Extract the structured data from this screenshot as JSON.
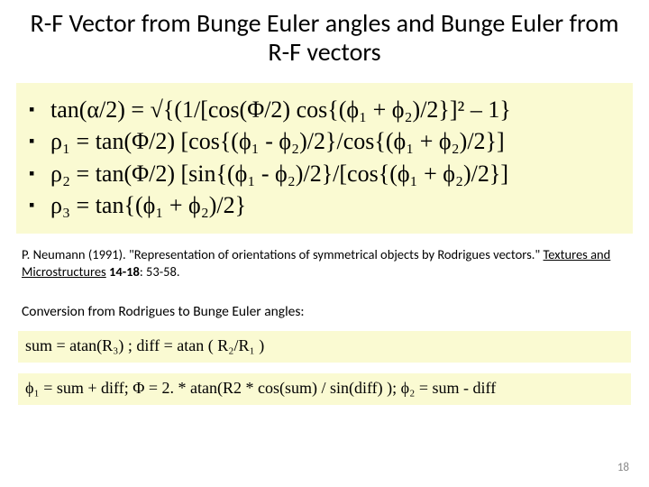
{
  "title": "R-F Vector from Bunge Euler angles and Bunge Euler from R-F vectors",
  "bullets": [
    "tan(α/2) = √{(1/[cos(Φ/2) cos{(ϕ₁ + ϕ₂)/2}]² – 1}",
    "ρ₁ = tan(Φ/2) [cos{(ϕ₁ - ϕ₂)/2}/cos{(ϕ₁ + ϕ₂)/2}]",
    "ρ₂ = tan(Φ/2) [sin{(ϕ₁ - ϕ₂)/2}/[cos{(ϕ₁ + ϕ₂)/2}]",
    "ρ₃ = tan{(ϕ₁ + ϕ₂)/2}"
  ],
  "reference": {
    "prefix": "P. Neumann (1991). \"Representation of orientations of symmetrical objects by Rodrigues vectors.\" ",
    "journal": "Textures and Microstructures",
    "suffix": " ",
    "volume": "14-18",
    "tail": ": 53-58."
  },
  "conv_label": "Conversion from Rodrigues to Bunge Euler angles:",
  "eq1": "sum = atan(R₃) ;  diff = atan ( R₂/R₁ )",
  "eq2": "ϕ₁ = sum + diff;  Φ = 2. * atan(R2 * cos(sum) / sin(diff) ); ϕ₂ = sum - diff",
  "pagenum": "18"
}
